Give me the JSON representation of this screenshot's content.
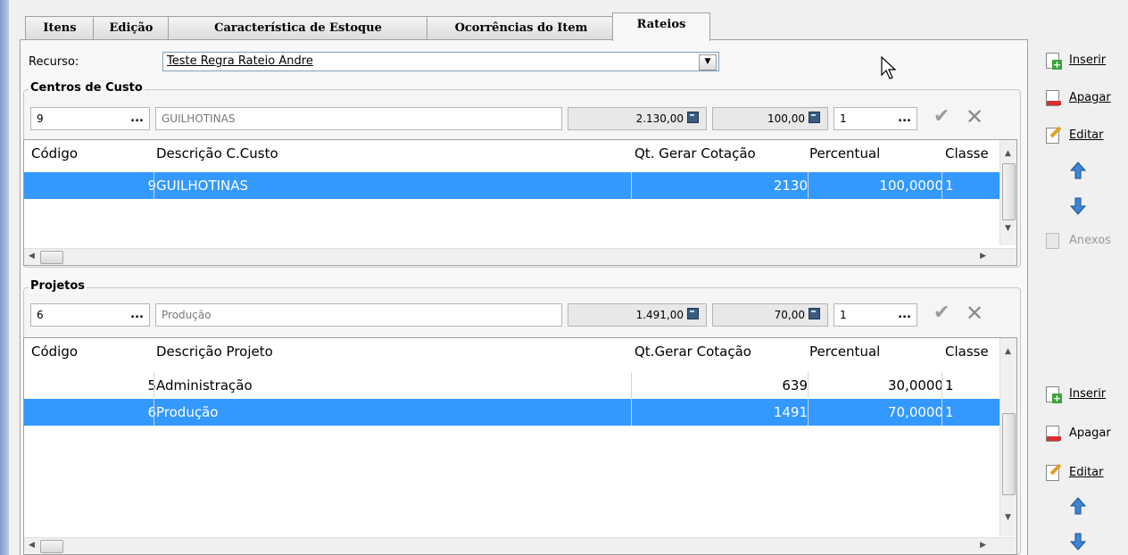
{
  "tabs": [
    "Itens",
    "Edição",
    "Característica de Estoque",
    "Ocorrências do Item",
    "Rateios"
  ],
  "recurso": {
    "label": "Recurso:",
    "value": "Teste Regra Rateio Andre"
  },
  "centros": {
    "title": "Centros de Custo",
    "code": "9",
    "desc": "GUILHOTINAS",
    "qt": "2.130,00",
    "perc": "100,00",
    "classe": "1",
    "headers": [
      "Código",
      "Descrição C.Custo",
      "Qt. Gerar Cotação",
      "Percentual",
      "Classe"
    ],
    "rows": [
      {
        "codigo": "9",
        "descricao": "GUILHOTINAS",
        "qt": "2130",
        "percentual": "100,0000",
        "classe": "1",
        "selected": true
      }
    ]
  },
  "projetos": {
    "title": "Projetos",
    "code": "6",
    "desc": "Produção",
    "qt": "1.491,00",
    "perc": "70,00",
    "classe": "1",
    "headers": [
      "Código",
      "Descrição Projeto",
      "Qt.Gerar Cotação",
      "Percentual",
      "Classe"
    ],
    "rows": [
      {
        "codigo": "5",
        "descricao": "Administração",
        "qt": "639",
        "percentual": "30,0000",
        "classe": "1",
        "selected": false
      },
      {
        "codigo": "6",
        "descricao": "Produção",
        "qt": "1491",
        "percentual": "70,0000",
        "classe": "1",
        "selected": true
      }
    ]
  },
  "side_top": {
    "inserir": "Inserir",
    "apagar": "Apagar",
    "editar": "Editar",
    "anexos": "Anexos"
  },
  "side_bottom": {
    "inserir": "Inserir",
    "apagar": "Apagar",
    "editar": "Editar"
  },
  "dots": "...",
  "colors": {
    "selection": "#3399ff",
    "tab_border": "#a0a0a0"
  }
}
